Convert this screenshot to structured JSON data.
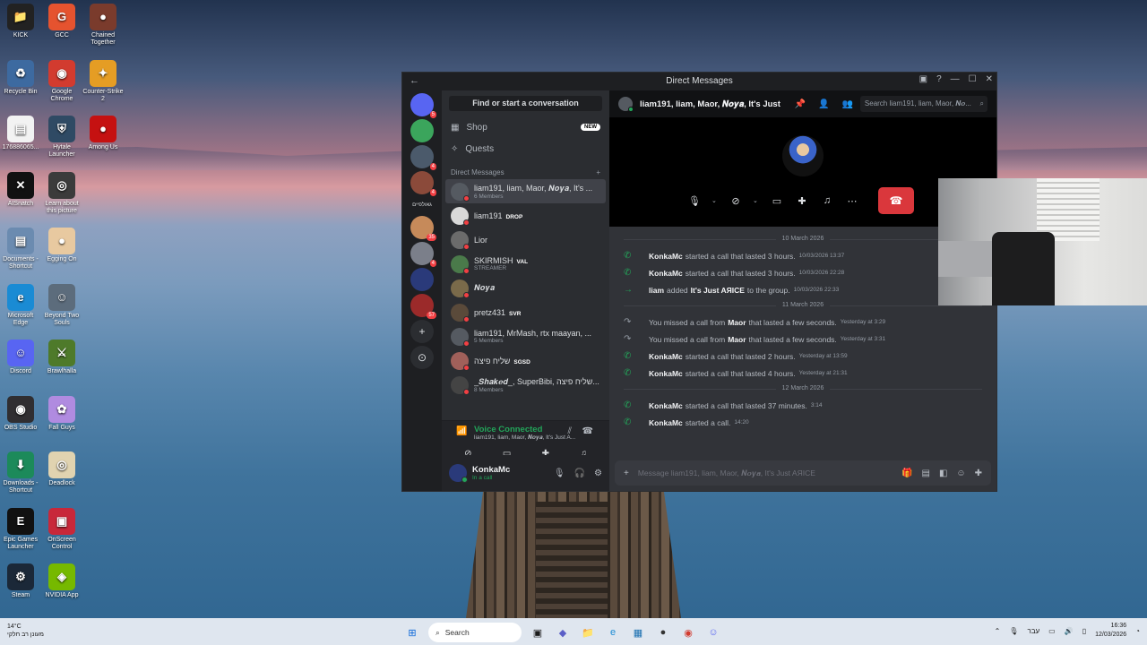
{
  "desktop_icons": [
    {
      "label": "KICK",
      "color": "#222222",
      "glyph": "📁",
      "col": 0,
      "row": 0
    },
    {
      "label": "GCC",
      "color": "#e5532f",
      "glyph": "G",
      "col": 1,
      "row": 0
    },
    {
      "label": "Chained Together",
      "color": "#7a3b2c",
      "glyph": "●",
      "col": 2,
      "row": 0
    },
    {
      "label": "Recycle Bin",
      "color": "#3d6aa0",
      "glyph": "♻",
      "col": 0,
      "row": 1
    },
    {
      "label": "Google Chrome",
      "color": "#d23b2f",
      "glyph": "◉",
      "col": 1,
      "row": 1
    },
    {
      "label": "Counter-Strike 2",
      "color": "#e59d24",
      "glyph": "✦",
      "col": 2,
      "row": 1
    },
    {
      "label": "176886065...",
      "color": "#f2f2f2",
      "glyph": "▤",
      "col": 0,
      "row": 2
    },
    {
      "label": "Hytale Launcher",
      "color": "#2f4a64",
      "glyph": "⛨",
      "col": 1,
      "row": 2
    },
    {
      "label": "Among Us",
      "color": "#c51111",
      "glyph": "●",
      "col": 2,
      "row": 2
    },
    {
      "label": "AISnatch",
      "color": "#111111",
      "glyph": "✕",
      "col": 0,
      "row": 3
    },
    {
      "label": "Learn about this picture",
      "color": "#3b3b3b",
      "glyph": "◎",
      "col": 1,
      "row": 3
    },
    {
      "label": "Documents - Shortcut",
      "color": "#6b8bb0",
      "glyph": "▤",
      "col": 0,
      "row": 4
    },
    {
      "label": "Egging On",
      "color": "#e8c9a0",
      "glyph": "●",
      "col": 1,
      "row": 4
    },
    {
      "label": "Microsoft Edge",
      "color": "#1a8bd4",
      "glyph": "e",
      "col": 0,
      "row": 5
    },
    {
      "label": "Beyond Two Souls",
      "color": "#5c6c7c",
      "glyph": "☺",
      "col": 1,
      "row": 5
    },
    {
      "label": "Discord",
      "color": "#5865f2",
      "glyph": "☺",
      "col": 0,
      "row": 6
    },
    {
      "label": "Brawlhalla",
      "color": "#4e7a2a",
      "glyph": "⚔",
      "col": 1,
      "row": 6
    },
    {
      "label": "OBS Studio",
      "color": "#302e31",
      "glyph": "◉",
      "col": 0,
      "row": 7
    },
    {
      "label": "Fall Guys",
      "color": "#b08be0",
      "glyph": "✿",
      "col": 1,
      "row": 7
    },
    {
      "label": "Downloads - Shortcut",
      "color": "#1c8a5a",
      "glyph": "⬇",
      "col": 0,
      "row": 8
    },
    {
      "label": "Deadlock",
      "color": "#e0d3b0",
      "glyph": "◎",
      "col": 1,
      "row": 8
    },
    {
      "label": "Epic Games Launcher",
      "color": "#111111",
      "glyph": "E",
      "col": 0,
      "row": 9
    },
    {
      "label": "OnScreen Control",
      "color": "#c8283a",
      "glyph": "▣",
      "col": 1,
      "row": 9
    },
    {
      "label": "Steam",
      "color": "#1b2838",
      "glyph": "⚙",
      "col": 0,
      "row": 10
    },
    {
      "label": "NVIDIA App",
      "color": "#76b900",
      "glyph": "◈",
      "col": 1,
      "row": 10
    }
  ],
  "window": {
    "title": "Direct Messages"
  },
  "servers": [
    {
      "name": "discord-home",
      "color": "#5865f2",
      "badge": "5"
    },
    {
      "name": "server-2",
      "color": "#3ba55c",
      "badge": ""
    },
    {
      "name": "server-3",
      "color": "#4b5a6b",
      "badge": "4"
    },
    {
      "name": "server-4",
      "color": "#8b4a3a",
      "badge": "4"
    },
    {
      "name": "server-text",
      "color": "",
      "badge": "",
      "text": "גאולפיים"
    },
    {
      "name": "server-6",
      "color": "#c68a5a",
      "badge": "35"
    },
    {
      "name": "server-7",
      "color": "#7b7f8a",
      "badge": "4"
    },
    {
      "name": "server-8",
      "color": "#2a3a7a",
      "badge": ""
    },
    {
      "name": "server-9",
      "color": "#9b2a2a",
      "badge": "57"
    }
  ],
  "dm": {
    "find": "Find or start a conversation",
    "shop": "Shop",
    "new_badge": "NEW",
    "quests": "Quests",
    "section": "Direct Messages",
    "add": "+",
    "items": [
      {
        "name": "liam191, liam, Maor, 𝑵𝒐𝒚𝒂, It's ...",
        "sub": "6 Members",
        "color": "#555a61",
        "active": true,
        "tag": ""
      },
      {
        "name": "liam191",
        "sub": "",
        "color": "#d9d9d9",
        "tag": "DROP"
      },
      {
        "name": "Lior",
        "sub": "",
        "color": "#6b6b6b",
        "tag": ""
      },
      {
        "name": "SKIRMISH",
        "sub": "STREAMER",
        "color": "#4a7a4a",
        "tag": "VAL"
      },
      {
        "name": "𝑵𝒐𝒚𝒂",
        "sub": "",
        "color": "#7a6a4a",
        "tag": ""
      },
      {
        "name": "pretz431",
        "sub": "",
        "color": "#5a4a3a",
        "tag": "SVR"
      },
      {
        "name": "liam191, MrMash, rtx maayan, ...",
        "sub": "5 Members",
        "color": "#555a61",
        "tag": ""
      },
      {
        "name": "שליח פיצה",
        "sub": "",
        "color": "#a0605a",
        "tag": "SGSD"
      },
      {
        "name": "_𝑺𝒉𝒂𝒌𝒆𝒅_, SuperBibi, שליח פיצה...",
        "sub": "8 Members",
        "color": "#444444",
        "tag": ""
      }
    ]
  },
  "voice": {
    "title": "Voice Connected",
    "sub": "liam191, liam, Maor, 𝑵𝒐𝒚𝒂, It's Just A..."
  },
  "user": {
    "name": "KonkaMc",
    "status": "In a call"
  },
  "header": {
    "title": "liam191, liam, Maor, 𝑵𝒐𝒚𝒂, It's Just A...",
    "search_placeholder": "Search liam191, liam, Maor, 𝑵𝒐..."
  },
  "messages": [
    {
      "type": "date",
      "text": "10 March 2026"
    },
    {
      "type": "ok",
      "user": "KonkaMc",
      "text": "started a call that lasted 3 hours.",
      "ts": "10/03/2026 13:37"
    },
    {
      "type": "ok",
      "user": "KonkaMc",
      "text": "started a call that lasted 3 hours.",
      "ts": "10/03/2026 22:28"
    },
    {
      "type": "join",
      "user": "liam",
      "text": "added",
      "target": "It's Just AЯICE",
      "text2": "to the group.",
      "ts": "10/03/2026 22:33"
    },
    {
      "type": "date",
      "text": "11 March 2026"
    },
    {
      "type": "miss",
      "pre": "You missed a call from",
      "user": "Maor",
      "text": "that lasted a few seconds.",
      "ts": "Yesterday at 3:29"
    },
    {
      "type": "miss",
      "pre": "You missed a call from",
      "user": "Maor",
      "text": "that lasted a few seconds.",
      "ts": "Yesterday at 3:31"
    },
    {
      "type": "ok",
      "user": "KonkaMc",
      "text": "started a call that lasted 2 hours.",
      "ts": "Yesterday at 13:59"
    },
    {
      "type": "ok",
      "user": "KonkaMc",
      "text": "started a call that lasted 4 hours.",
      "ts": "Yesterday at 21:31"
    },
    {
      "type": "date",
      "text": "12 March 2026"
    },
    {
      "type": "ok",
      "user": "KonkaMc",
      "text": "started a call that lasted 37 minutes.",
      "ts": "3:14"
    },
    {
      "type": "ok",
      "user": "KonkaMc",
      "text": "started a call.",
      "ts": "14:20"
    }
  ],
  "composer": {
    "placeholder": "Message liam191, liam, Maor, 𝑵𝒐𝒚𝒂, It's Just AЯICE"
  },
  "taskbar": {
    "temp": "14°C",
    "weather": "מעונן רב חלקי",
    "search": "Search",
    "lang": "עבר",
    "time": "16:36",
    "date": "12/03/2026"
  }
}
